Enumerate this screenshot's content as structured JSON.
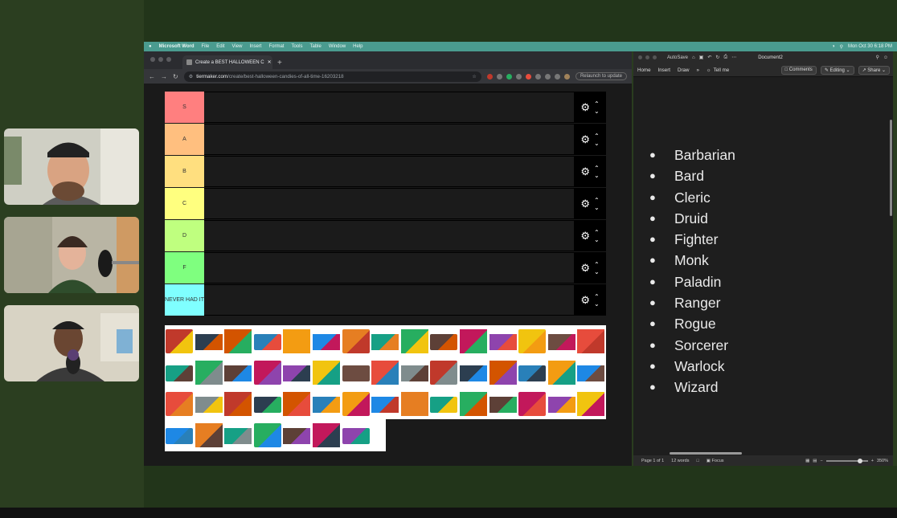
{
  "menubar": {
    "app": "Microsoft Word",
    "items": [
      "File",
      "Edit",
      "View",
      "Insert",
      "Format",
      "Tools",
      "Table",
      "Window",
      "Help"
    ],
    "clock": "Mon Oct 30  6:18 PM"
  },
  "browser": {
    "tab_title": "Create a BEST HALLOWEEN C",
    "url_host": "tiermaker.com",
    "url_path": "/create/best-halloween-candies-of-all-time-16203218",
    "relaunch": "Relaunch to update"
  },
  "tiers": [
    {
      "label": "S",
      "color": "#ff7f7f"
    },
    {
      "label": "A",
      "color": "#ffbf7f"
    },
    {
      "label": "B",
      "color": "#ffdf7f"
    },
    {
      "label": "C",
      "color": "#ffff7f"
    },
    {
      "label": "D",
      "color": "#bfff7f"
    },
    {
      "label": "F",
      "color": "#7fff7f"
    },
    {
      "label": "NEVER HAD IT",
      "color": "#7fffff"
    }
  ],
  "word": {
    "autosave": "AutoSave",
    "doc_name": "Document2",
    "ribbon": [
      "Home",
      "Insert",
      "Draw"
    ],
    "tell_me": "Tell me",
    "comments": "Comments",
    "editing": "Editing",
    "share": "Share",
    "list": [
      "Barbarian",
      "Bard",
      "Cleric",
      "Druid",
      "Fighter",
      "Monk",
      "Paladin",
      "Ranger",
      "Rogue",
      "Sorcerer",
      "Warlock",
      "Wizard"
    ],
    "status_page": "Page 1 of 1",
    "status_words": "12 words",
    "focus": "Focus",
    "zoom": "350%"
  }
}
